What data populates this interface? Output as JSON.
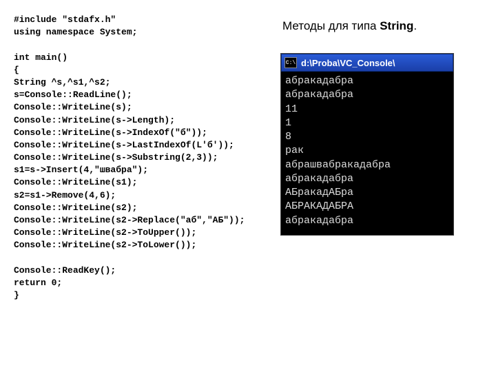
{
  "heading": {
    "prefix": "Методы для типа ",
    "bold": "String",
    "suffix": "."
  },
  "code": {
    "lines": [
      "#include \"stdafx.h\"",
      "using namespace System;",
      "",
      "int main()",
      "{",
      "String ^s,^s1,^s2;",
      "s=Console::ReadLine();",
      "Console::WriteLine(s);",
      "Console::WriteLine(s->Length);",
      "Console::WriteLine(s->IndexOf(\"б\"));",
      "Console::WriteLine(s->LastIndexOf(L'б'));",
      "Console::WriteLine(s->Substring(2,3));",
      "s1=s->Insert(4,\"швабра\");",
      "Console::WriteLine(s1);",
      "s2=s1->Remove(4,6);",
      "Console::WriteLine(s2);",
      "Console::WriteLine(s2->Replace(\"аб\",\"АБ\"));",
      "Console::WriteLine(s2->ToUpper());",
      "Console::WriteLine(s2->ToLower());",
      "",
      "Console::ReadKey();",
      "return 0;",
      "}"
    ]
  },
  "console": {
    "icon_text": "C:\\",
    "title": "d:\\Proba\\VC_Console\\",
    "output": [
      "абракадабра",
      "абракадабра",
      "11",
      "1",
      "8",
      "рак",
      "абрашвабракадабра",
      "абракадабра",
      "АБракадАБра",
      "АБРАКАДАБРА",
      "абракадабра"
    ]
  }
}
